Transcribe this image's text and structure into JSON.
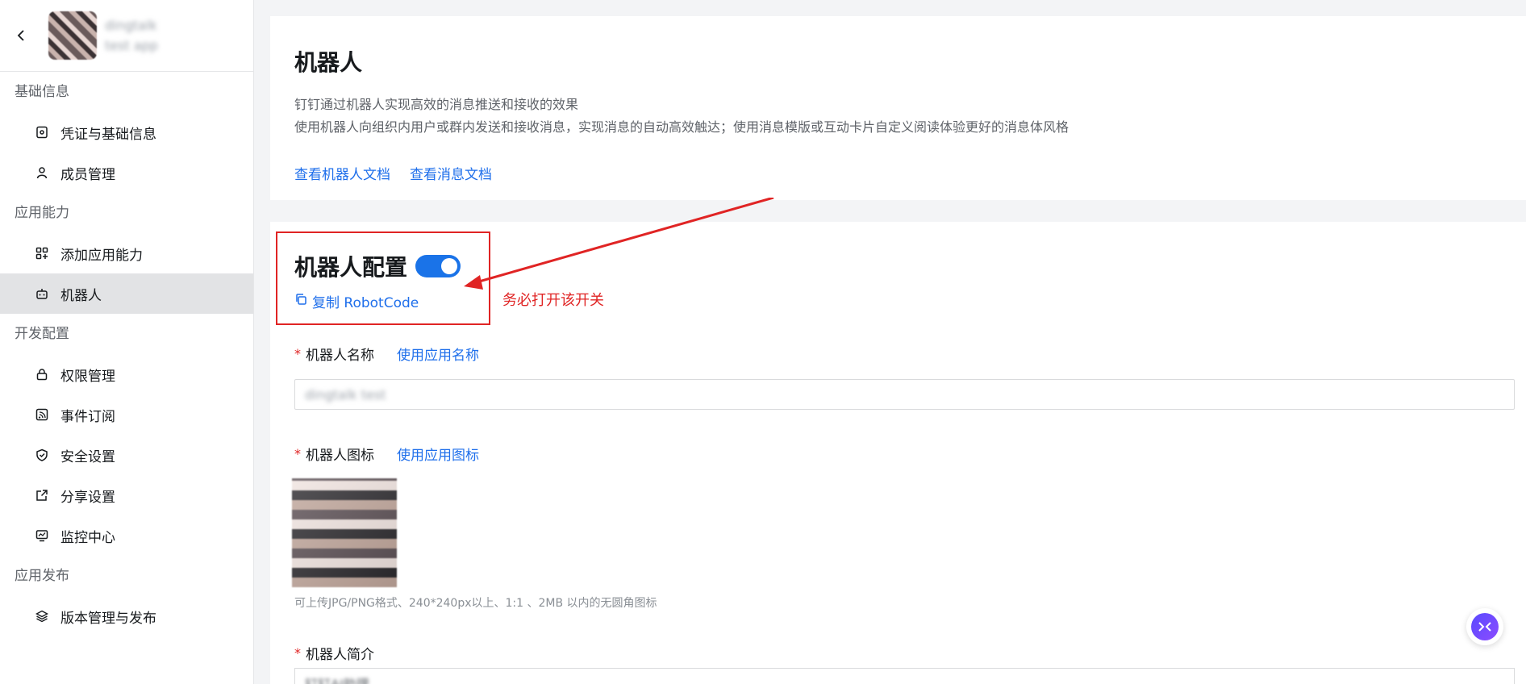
{
  "sidebar": {
    "app_name": "dingtalk",
    "app_sub": "test app",
    "groups": [
      {
        "label": "基础信息",
        "items": [
          {
            "label": "凭证与基础信息",
            "icon": "credential-icon"
          },
          {
            "label": "成员管理",
            "icon": "user-icon"
          }
        ]
      },
      {
        "label": "应用能力",
        "items": [
          {
            "label": "添加应用能力",
            "icon": "apps-plus-icon"
          },
          {
            "label": "机器人",
            "icon": "robot-icon",
            "active": true
          }
        ]
      },
      {
        "label": "开发配置",
        "items": [
          {
            "label": "权限管理",
            "icon": "lock-icon"
          },
          {
            "label": "事件订阅",
            "icon": "rss-icon"
          },
          {
            "label": "安全设置",
            "icon": "shield-icon"
          },
          {
            "label": "分享设置",
            "icon": "share-icon"
          },
          {
            "label": "监控中心",
            "icon": "monitor-icon"
          }
        ]
      },
      {
        "label": "应用发布",
        "items": [
          {
            "label": "版本管理与发布",
            "icon": "layers-icon"
          }
        ]
      }
    ]
  },
  "intro": {
    "title": "机器人",
    "desc_line1": "钉钉通过机器人实现高效的消息推送和接收的效果",
    "desc_line2": "使用机器人向组织内用户或群内发送和接收消息，实现消息的自动高效触达；使用消息模版或互动卡片自定义阅读体验更好的消息体风格",
    "link_robot_doc": "查看机器人文档",
    "link_msg_doc": "查看消息文档"
  },
  "config": {
    "title": "机器人配置",
    "toggle_on": true,
    "copy_label": "复制 RobotCode",
    "annotation": "务必打开该开关",
    "annotation_color": "#e02424",
    "name_label": "机器人名称",
    "name_link": "使用应用名称",
    "name_value": "dingtalk test",
    "icon_label": "机器人图标",
    "icon_link": "使用应用图标",
    "icon_hint": "可上传JPG/PNG格式、240*240px以上、1:1 、2MB 以内的无圆角图标",
    "intro_label": "机器人简介",
    "intro_value": "钉钉AI助理"
  },
  "colors": {
    "accent": "#1a73e8",
    "link": "#1f6feb"
  }
}
